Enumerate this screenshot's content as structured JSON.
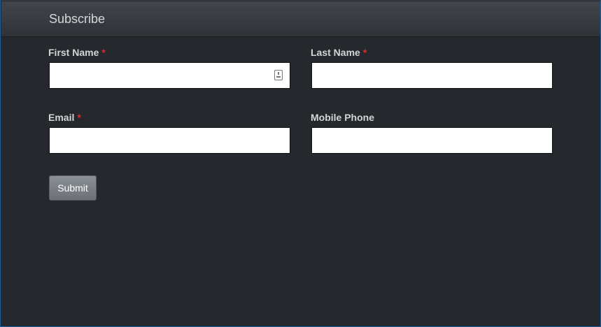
{
  "form": {
    "title": "Subscribe",
    "required_marker": "*",
    "first_name": {
      "label": "First Name",
      "value": "",
      "placeholder": ""
    },
    "last_name": {
      "label": "Last Name",
      "value": "",
      "placeholder": ""
    },
    "email": {
      "label": "Email",
      "value": "",
      "placeholder": ""
    },
    "mobile_phone": {
      "label": "Mobile Phone",
      "value": "",
      "placeholder": ""
    },
    "submit_label": "Submit"
  },
  "colors": {
    "panel_background": "#25282d",
    "header_background": "#3b3f45",
    "required_marker": "#e02b2b",
    "button": "#7a8086"
  },
  "icons": {
    "first_name_field_icon": "contact-card-icon"
  }
}
